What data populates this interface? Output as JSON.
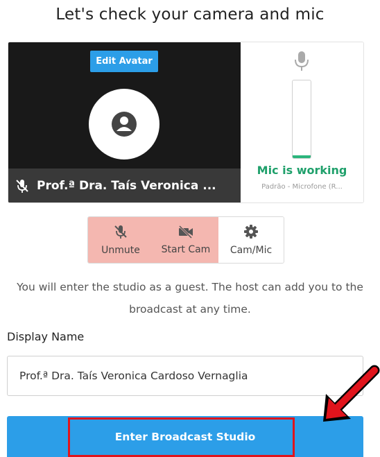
{
  "page": {
    "title": "Let's check your camera and mic"
  },
  "preview": {
    "edit_avatar_label": "Edit Avatar",
    "participant_name": "Prof.ª Dra. Taís Veronica ...",
    "mic_status": "Mic is working",
    "mic_device": "Padrão - Microfone (R...",
    "mic_level": 0.04
  },
  "controls": {
    "unmute_label": "Unmute",
    "start_cam_label": "Start Cam",
    "cam_mic_label": "Cam/Mic"
  },
  "guest_notice": "You will enter the studio as a guest. The host can add you to the broadcast at any time.",
  "display_name": {
    "label": "Display Name",
    "value": "Prof.ª Dra. Taís Veronica Cardoso Vernaglia"
  },
  "enter_button_label": "Enter Broadcast Studio",
  "colors": {
    "accent": "#2c9ee8",
    "mic_ok": "#1fa06b",
    "control_off": "#f4b7b0",
    "annotation": "#e0141c"
  }
}
